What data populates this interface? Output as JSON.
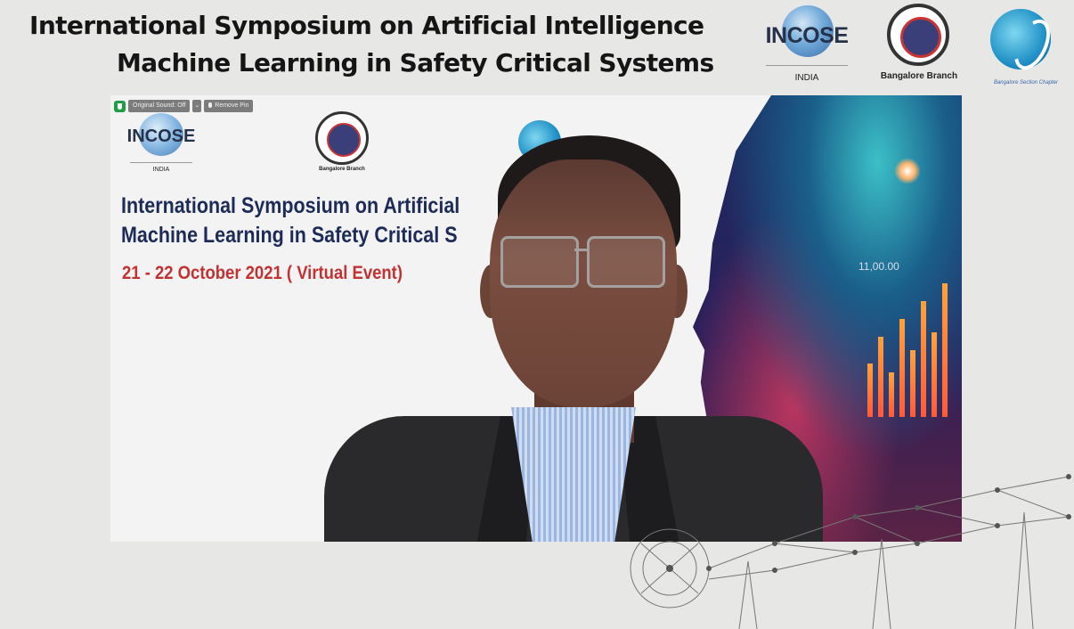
{
  "banner": {
    "title_line1": "International Symposium on Artificial Intelligence",
    "title_line2": "Machine Learning in Safety Critical Systems"
  },
  "logos": {
    "incose": {
      "word": "INCOSE",
      "sub": "INDIA"
    },
    "aero": {
      "caption": "Bangalore Branch"
    },
    "ieee": {
      "caption": "Bangalore Section Chapter"
    }
  },
  "video": {
    "toolbar": {
      "original_sound": "Original Sound: Off",
      "dropdown": "⌄",
      "remove_pin": "Remove Pin"
    },
    "slide": {
      "incose_word": "INCOSE",
      "incose_sub": "INDIA",
      "aero_caption": "Bangalore Branch",
      "title_line1": "International Symposium on Artificial",
      "title_line2": "Machine Learning in Safety Critical S",
      "date": "21 - 22  October 2021 ( Virtual Event)",
      "chart_price": "11,00.00"
    }
  },
  "colors": {
    "background": "#e7e7e6",
    "title_navy": "#1d2b57",
    "date_red": "#c23232",
    "badge_green": "#1f9e45"
  }
}
